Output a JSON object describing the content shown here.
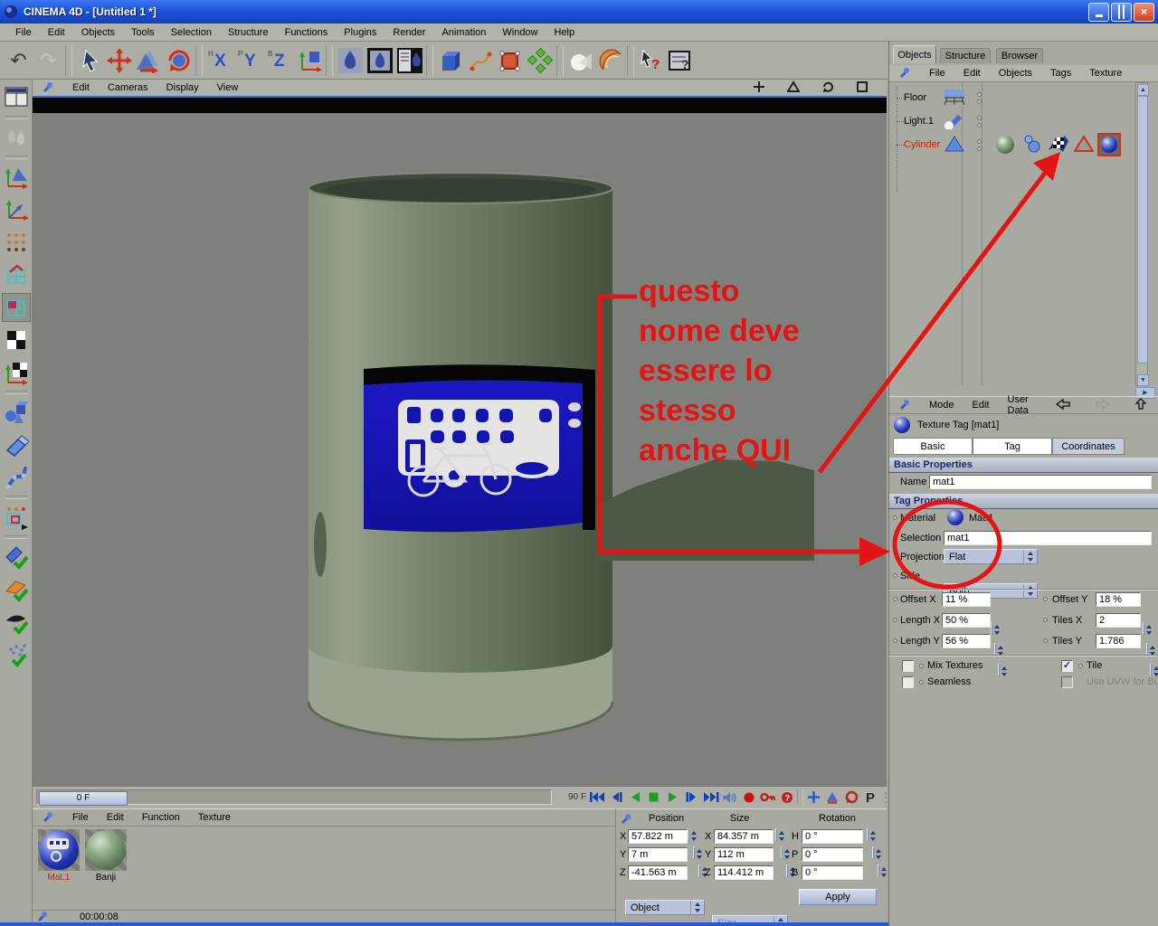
{
  "window": {
    "title": "CINEMA 4D - [Untitled 1 *]"
  },
  "menubar": {
    "items": [
      "File",
      "Edit",
      "Objects",
      "Tools",
      "Selection",
      "Structure",
      "Functions",
      "Plugins",
      "Render",
      "Animation",
      "Window",
      "Help"
    ]
  },
  "viewport_menu": {
    "items": [
      "Edit",
      "Cameras",
      "Display",
      "View"
    ]
  },
  "timeline": {
    "current_frame": "0 F",
    "end_frame": "90 F"
  },
  "objects_panel": {
    "tabs": [
      "Objects",
      "Structure",
      "Browser"
    ],
    "menu": [
      "File",
      "Edit",
      "Objects",
      "Tags",
      "Texture"
    ],
    "items": [
      {
        "name": "Floor"
      },
      {
        "name": "Light.1"
      },
      {
        "name": "Cylinder"
      }
    ]
  },
  "attributes": {
    "menu": [
      "Mode",
      "Edit",
      "User Data"
    ],
    "title": "Texture Tag [mat1]",
    "tabs": [
      "Basic",
      "Tag",
      "Coordinates"
    ],
    "basic_header": "Basic Properties",
    "name_label": "Name",
    "name_value": "mat1",
    "tag_header": "Tag Properties",
    "material_label": "Material",
    "material_value": "Mat.1",
    "selection_label": "Selection",
    "selection_value": "mat1",
    "projection_label": "Projection",
    "projection_value": "Flat",
    "side_label": "Side",
    "side_value": "Both",
    "fields": {
      "offset_x_label": "Offset X",
      "offset_x": "11 %",
      "offset_y_label": "Offset Y",
      "offset_y": "18 %",
      "length_x_label": "Length X",
      "length_x": "50 %",
      "length_y_label": "Length Y",
      "length_y": "56 %",
      "tiles_x_label": "Tiles X",
      "tiles_x": "2",
      "tiles_y_label": "Tiles Y",
      "tiles_y": "1.786"
    },
    "checks": {
      "mix": "Mix Textures",
      "seamless": "Seamless",
      "tile": "Tile",
      "uvw": "Use UVW for Bu"
    }
  },
  "materials_panel": {
    "menu": [
      "File",
      "Edit",
      "Function",
      "Texture"
    ],
    "items": [
      {
        "name": "Mat.1"
      },
      {
        "name": "Banji"
      }
    ]
  },
  "coordinates": {
    "headers": [
      "Position",
      "Size",
      "Rotation"
    ],
    "position": {
      "x_label": "X",
      "x": "57.822 m",
      "y_label": "Y",
      "y": "7 m",
      "z_label": "Z",
      "z": "-41.563 m"
    },
    "size": {
      "x_label": "X",
      "x": "84.357 m",
      "y_label": "Y",
      "y": "112 m",
      "z_label": "Z",
      "z": "114.412 m"
    },
    "rotation": {
      "h_label": "H",
      "h": "0 °",
      "p_label": "P",
      "p": "0 °",
      "b_label": "B",
      "b": "0 °"
    },
    "object_dropdown": "Object",
    "size_dropdown": "Size",
    "apply_button": "Apply"
  },
  "statusbar": {
    "time": "00:00:08"
  },
  "annotation": {
    "lines": [
      "questo",
      "nome deve",
      "essere lo",
      "stesso",
      "anche QUI"
    ],
    "color": "#e41414"
  },
  "icons": {
    "check": "✓",
    "close": "×",
    "question": "?",
    "undo": "↶",
    "redo": "↷"
  },
  "colors": {
    "ui_gray": "#a8aaa2",
    "titlebar_blue": "#1e55dc",
    "accent_blue": "#b8c2da",
    "annotation_red": "#e41414",
    "selected_name_red": "#cc2200",
    "sign_blue": "#1315ae",
    "viewport_gray": "#7e817b"
  }
}
